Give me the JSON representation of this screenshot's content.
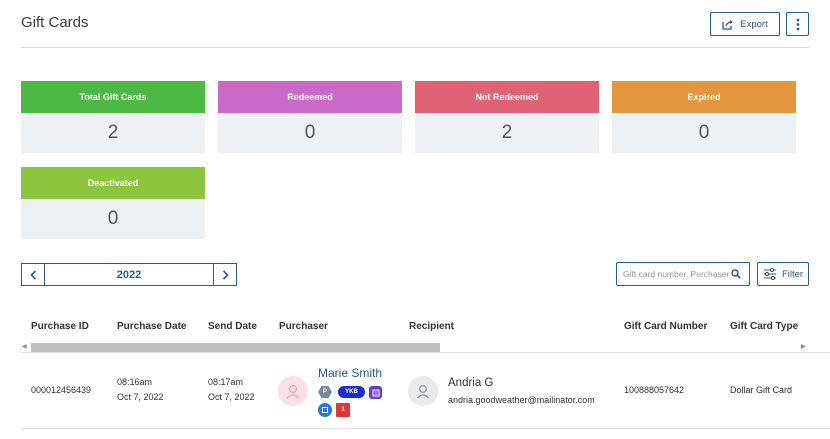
{
  "page": {
    "title": "Gift Cards"
  },
  "toolbar": {
    "export_label": "Export"
  },
  "stats": [
    {
      "label": "Total Gift Cards",
      "value": "2",
      "color": "#4cb944"
    },
    {
      "label": "Redeemed",
      "value": "0",
      "color": "#c96ac9"
    },
    {
      "label": "Not Redeemed",
      "value": "2",
      "color": "#e06375"
    },
    {
      "label": "Expired",
      "value": "0",
      "color": "#e2963e"
    },
    {
      "label": "Deactivated",
      "value": "0",
      "color": "#8cc63f"
    }
  ],
  "year_picker": {
    "value": "2022"
  },
  "search": {
    "placeholder": "Gift card number, Purchaser"
  },
  "filter": {
    "label": "Filter"
  },
  "table": {
    "headers": [
      "Purchase ID",
      "Purchase Date",
      "Send Date",
      "Purchaser",
      "Recipient",
      "Gift Card Number",
      "Gift Card Type"
    ],
    "rows": [
      {
        "purchase_id": "000012456439",
        "purchase_time": "08:16am",
        "purchase_date": "Oct 7, 2022",
        "send_time": "08:17am",
        "send_date": "Oct 7, 2022",
        "purchaser_name": "Marie Smith",
        "badges": {
          "p": "P",
          "ykb": "YKB",
          "one": "1"
        },
        "recipient_name": "Andria G",
        "recipient_email": "andria.goodweather@mailinator.com",
        "gift_card_number": "100888057642",
        "gift_card_type": "Dollar Gift Card"
      }
    ]
  },
  "colors": {
    "accent": "#2c5a8c"
  }
}
